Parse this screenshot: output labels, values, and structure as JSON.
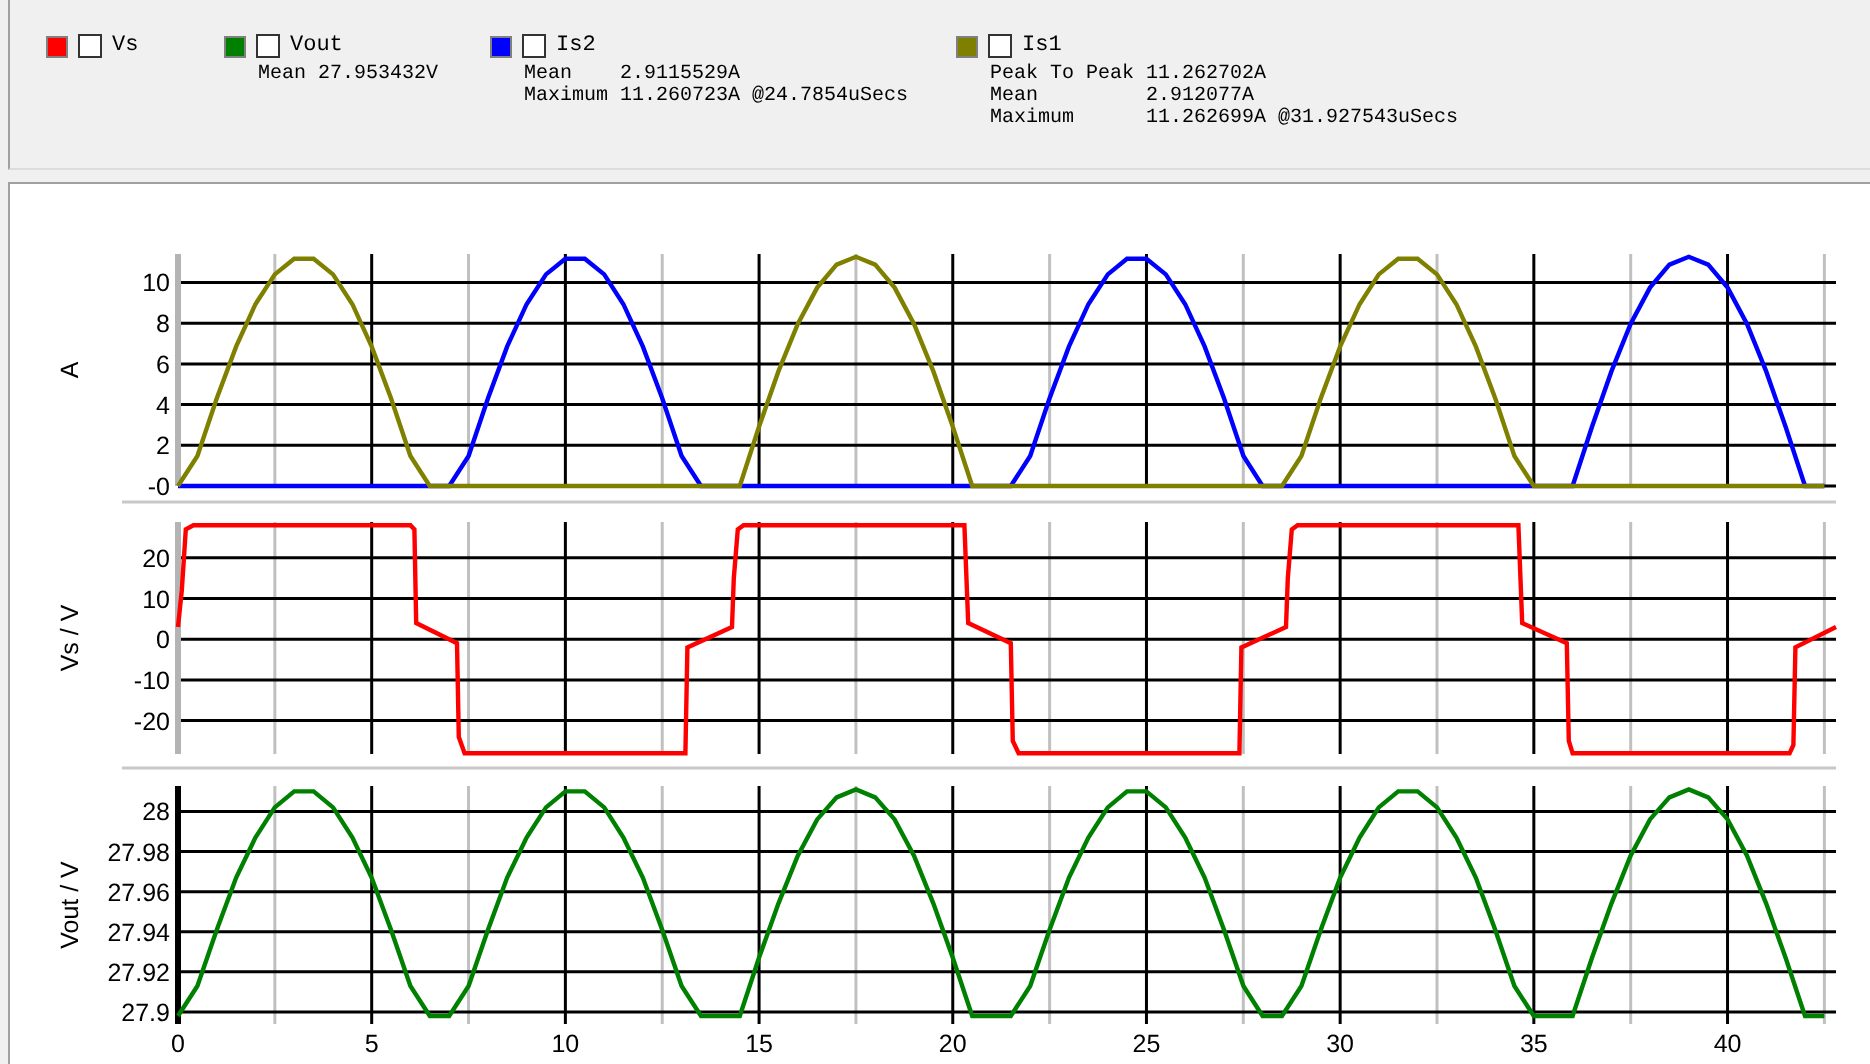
{
  "legend": [
    {
      "name": "Vs",
      "color": "#ff0000",
      "checked": false
    },
    {
      "name": "Vout",
      "color": "#008000",
      "checked": false,
      "stats": [
        {
          "label": "Mean",
          "value": "27.953432V"
        }
      ]
    },
    {
      "name": "Is2",
      "color": "#0000ff",
      "checked": false,
      "stats": [
        {
          "label": "Mean",
          "value": "2.9115529A"
        },
        {
          "label": "Maximum",
          "value": "11.260723A @24.7854uSecs"
        }
      ]
    },
    {
      "name": "Is1",
      "color": "#808000",
      "checked": false,
      "stats": [
        {
          "label": "Peak To Peak",
          "value": "11.262702A"
        },
        {
          "label": "Mean",
          "value": "2.912077A"
        },
        {
          "label": "Maximum",
          "value": "11.262699A @31.927543uSecs"
        }
      ]
    }
  ],
  "plots": [
    {
      "chart_data": {
        "type": "line",
        "grid": true,
        "ylabel": "A",
        "xlim": [
          0,
          42.8
        ],
        "ylim": [
          0,
          11.4
        ],
        "yticks": [
          {
            "value": 0,
            "label": "-0"
          },
          2,
          4,
          6,
          8,
          10
        ],
        "x": [
          0,
          0.5,
          1,
          1.5,
          2,
          2.5,
          3,
          3.5,
          4,
          4.5,
          5,
          5.5,
          6,
          6.5,
          7,
          7.5,
          8,
          8.5,
          9,
          9.5,
          10,
          10.5,
          11,
          11.5,
          12,
          12.5,
          13,
          13.5,
          14,
          14.5,
          15,
          15.5,
          16,
          16.5,
          17,
          17.5,
          18,
          18.5,
          19,
          19.5,
          20,
          20.5,
          21,
          21.5,
          22,
          22.5,
          23,
          23.5,
          24,
          24.5,
          25,
          25.5,
          26,
          26.5,
          27,
          27.5,
          28,
          28.5,
          29,
          29.5,
          30,
          30.5,
          31,
          31.5,
          32,
          32.5,
          33,
          33.5,
          34,
          34.5,
          35,
          35.5,
          36,
          36.5,
          37,
          37.5,
          38,
          38.5,
          39,
          39.5,
          40,
          40.5,
          41,
          41.5,
          42,
          42.5
        ],
        "series": [
          {
            "color": "#0000ff",
            "values": [
              0,
              0,
              0,
              0,
              0,
              0,
              0,
              0,
              0,
              0,
              0,
              0,
              0,
              0,
              0,
              1.47,
              4.31,
              6.86,
              8.93,
              10.4,
              11.16,
              11.16,
              10.4,
              8.93,
              6.86,
              4.31,
              1.47,
              0,
              0,
              0,
              0,
              0,
              0,
              0,
              0,
              0,
              0,
              0,
              0,
              0,
              0,
              0,
              0,
              0,
              1.47,
              4.31,
              6.86,
              8.93,
              10.4,
              11.16,
              11.16,
              10.4,
              8.93,
              6.86,
              4.31,
              1.47,
              0,
              0,
              0,
              0,
              0,
              0,
              0,
              0,
              0,
              0,
              0,
              0,
              0,
              0,
              0,
              0,
              0,
              2.91,
              5.63,
              7.96,
              9.75,
              10.88,
              11.26,
              10.88,
              9.75,
              7.96,
              5.63,
              2.91,
              0,
              0
            ]
          },
          {
            "color": "#808000",
            "values": [
              0,
              1.47,
              4.31,
              6.86,
              8.93,
              10.4,
              11.16,
              11.16,
              10.4,
              8.93,
              6.86,
              4.31,
              1.47,
              0,
              0,
              0,
              0,
              0,
              0,
              0,
              0,
              0,
              0,
              0,
              0,
              0,
              0,
              0,
              0,
              0,
              2.91,
              5.63,
              7.96,
              9.75,
              10.88,
              11.26,
              10.88,
              9.75,
              7.96,
              5.63,
              2.91,
              0,
              0,
              0,
              0,
              0,
              0,
              0,
              0,
              0,
              0,
              0,
              0,
              0,
              0,
              0,
              0,
              0,
              1.47,
              4.31,
              6.86,
              8.93,
              10.4,
              11.16,
              11.16,
              10.4,
              8.93,
              6.86,
              4.31,
              1.47,
              0,
              0,
              0,
              0,
              0,
              0,
              0,
              0,
              0,
              0,
              0,
              0,
              0,
              0,
              0,
              0
            ]
          }
        ]
      }
    },
    {
      "chart_data": {
        "type": "line",
        "grid": true,
        "ylabel": "Vs / V",
        "xlim": [
          0,
          42.8
        ],
        "ylim": [
          -28.2,
          28.8
        ],
        "yticks": [
          -20,
          -10,
          0,
          10,
          20
        ],
        "x": [
          0,
          0.1,
          0.2,
          0.4,
          6.0,
          6.1,
          6.15,
          7.2,
          7.25,
          7.4,
          13.1,
          13.15,
          14.3,
          14.35,
          14.45,
          14.6,
          20.3,
          20.4,
          21.5,
          21.55,
          21.7,
          27.4,
          27.45,
          28.6,
          28.65,
          28.75,
          28.9,
          34.6,
          34.7,
          35.85,
          35.9,
          36.0,
          41.6,
          41.7,
          41.75,
          42.8
        ],
        "series": [
          {
            "color": "#ff0000",
            "values": [
              3,
              12,
              27,
              28,
              28,
              27,
              4,
              -1,
              -24,
              -28,
              -28,
              -2,
              3,
              15,
              27,
              28,
              28,
              4,
              -1,
              -25,
              -28,
              -28,
              -2,
              3,
              15,
              27,
              28,
              28,
              4,
              -1,
              -25,
              -28,
              -28,
              -26,
              -2,
              3
            ]
          }
        ]
      }
    },
    {
      "chart_data": {
        "type": "line",
        "grid": true,
        "ylabel": "Vout / V",
        "xlim": [
          0,
          42.8
        ],
        "ylim": [
          27.894,
          28.0127
        ],
        "yticks": [
          27.9,
          27.92,
          27.94,
          27.96,
          27.98,
          28
        ],
        "xticks": [
          0,
          5,
          10,
          15,
          20,
          25,
          30,
          35,
          40
        ],
        "x": [
          0,
          0.5,
          1,
          1.5,
          2,
          2.5,
          3,
          3.5,
          4,
          4.5,
          5,
          5.5,
          6,
          6.5,
          7,
          7.5,
          8,
          8.5,
          9,
          9.5,
          10,
          10.5,
          11,
          11.5,
          12,
          12.5,
          13,
          13.5,
          14,
          14.5,
          15,
          15.5,
          16,
          16.5,
          17,
          17.5,
          18,
          18.5,
          19,
          19.5,
          20,
          20.5,
          21,
          21.5,
          22,
          22.5,
          23,
          23.5,
          24,
          24.5,
          25,
          25.5,
          26,
          26.5,
          27,
          27.5,
          28,
          28.5,
          29,
          29.5,
          30,
          30.5,
          31,
          31.5,
          32,
          32.5,
          33,
          33.5,
          34,
          34.5,
          35,
          35.5,
          36,
          36.5,
          37,
          37.5,
          38,
          38.5,
          39,
          39.5,
          40,
          40.5,
          41,
          41.5,
          42,
          42.5
        ],
        "series": [
          {
            "color": "#008000",
            "values": [
              27.898,
              27.913,
              27.941,
              27.967,
              27.987,
              28.002,
              28.01,
              28.01,
              28.002,
              27.987,
              27.967,
              27.941,
              27.913,
              27.898,
              27.898,
              27.913,
              27.941,
              27.967,
              27.987,
              28.002,
              28.01,
              28.01,
              28.002,
              27.987,
              27.967,
              27.941,
              27.913,
              27.898,
              27.898,
              27.898,
              27.927,
              27.954,
              27.978,
              27.996,
              28.007,
              28.011,
              28.007,
              27.996,
              27.978,
              27.954,
              27.927,
              27.898,
              27.898,
              27.898,
              27.913,
              27.941,
              27.967,
              27.987,
              28.002,
              28.01,
              28.01,
              28.002,
              27.987,
              27.967,
              27.941,
              27.913,
              27.898,
              27.898,
              27.913,
              27.941,
              27.967,
              27.987,
              28.002,
              28.01,
              28.01,
              28.002,
              27.987,
              27.967,
              27.941,
              27.913,
              27.898,
              27.898,
              27.898,
              27.927,
              27.954,
              27.978,
              27.996,
              28.007,
              28.011,
              28.007,
              27.996,
              27.978,
              27.954,
              27.927,
              27.898,
              27.898
            ]
          }
        ]
      }
    }
  ]
}
